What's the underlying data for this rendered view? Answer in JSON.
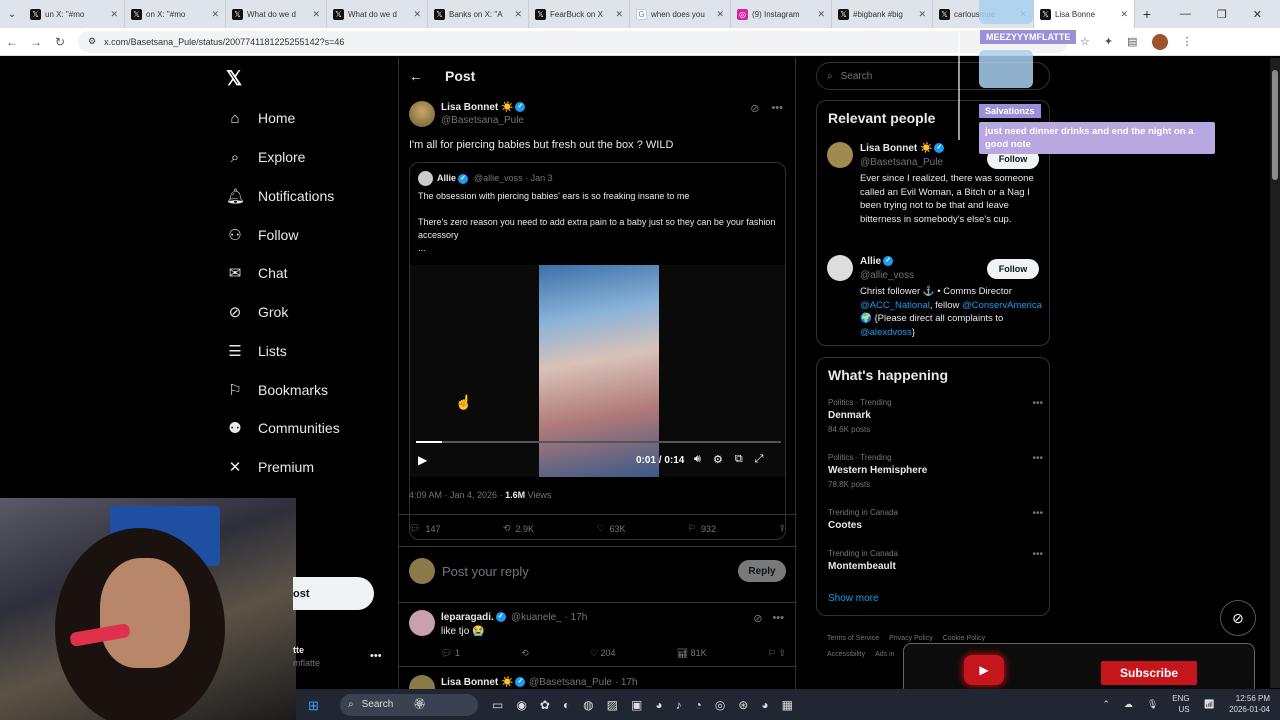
{
  "browser": {
    "tabs": [
      {
        "icon": "x-icon",
        "title": "un X: \"#mo",
        "active": false
      },
      {
        "icon": "x-icon",
        "title": "on X: \"#mo",
        "active": false
      },
      {
        "icon": "x-icon",
        "title": "What do we d",
        "active": false
      },
      {
        "icon": "x-icon",
        "title": "What do we d",
        "active": false
      },
      {
        "icon": "x-icon",
        "title": "Banks on X: \"A",
        "active": false
      },
      {
        "icon": "x-icon",
        "title": "FearBuck on X",
        "active": false
      },
      {
        "icon": "google-icon",
        "title": "when does you",
        "active": false
      },
      {
        "icon": "instagram-icon",
        "title": "(9) Instagram",
        "active": false
      },
      {
        "icon": "x-icon",
        "title": "#bigbank #big",
        "active": false
      },
      {
        "icon": "x-icon",
        "title": "carlousmae",
        "active": false
      },
      {
        "icon": "x-icon",
        "title": "Lisa Bonne",
        "active": true
      }
    ],
    "url": "x.com/Basetsana_Pule/status/2007741181225255142?s=46"
  },
  "nav": {
    "items": [
      {
        "icon": "home-icon",
        "glyph": "⌂",
        "label": "Home"
      },
      {
        "icon": "explore-icon",
        "glyph": "⌕",
        "label": "Explore"
      },
      {
        "icon": "bell-icon",
        "glyph": "🔔︎",
        "label": "Notifications"
      },
      {
        "icon": "follow-icon",
        "glyph": "⚇",
        "label": "Follow"
      },
      {
        "icon": "mail-icon",
        "glyph": "✉",
        "label": "Chat"
      },
      {
        "icon": "grok-icon",
        "glyph": "⊘",
        "label": "Grok"
      },
      {
        "icon": "lists-icon",
        "glyph": "☰",
        "label": "Lists"
      },
      {
        "icon": "bookmark-icon",
        "glyph": "⚐",
        "label": "Bookmarks"
      },
      {
        "icon": "communities-icon",
        "glyph": "⚉",
        "label": "Communities"
      },
      {
        "icon": "premium-icon",
        "glyph": "✕",
        "label": "Premium"
      }
    ],
    "post_label": "ost",
    "account_name": "tte",
    "account_user": "mflatte"
  },
  "post": {
    "header": "Post",
    "author_name": "Lisa Bonnet ☀️",
    "author_user": "@Basetsana_Pule",
    "text": "I'm all for piercing babies but fresh out the box ? WILD",
    "quote": {
      "name": "Allie",
      "user": "@allie_voss",
      "date": "· Jan 3",
      "line1": "The obsession with piercing babies' ears is so freaking insane to me",
      "line2": "There's zero reason you need to add extra pain to a baby just so they can be your fashion accessory",
      "line3": "...",
      "video_time": "0:01 / 0:14",
      "video_progress": 0.07
    },
    "timestamp": "4:09 AM · Jan 4, 2026 · ",
    "views": "1.6M",
    "views_label": " Views",
    "replies": "147",
    "reposts": "2.9K",
    "likes": "63K",
    "bookmarks": "932",
    "reply_placeholder": "Post your reply",
    "reply_button": "Reply"
  },
  "comments": [
    {
      "name": "leparagadi.",
      "user": "@kuanele_ · 17h",
      "text": "like tjo 😭",
      "replies": "1",
      "likes": "204",
      "views": "81K"
    },
    {
      "name": "Lisa Bonnet ☀️",
      "user": "@Basetsana_Pule · 17h"
    }
  ],
  "right": {
    "search_placeholder": "Search",
    "relevant_title": "Relevant people",
    "people": [
      {
        "name": "Lisa Bonnet ☀️",
        "user": "@Basetsana_Pule",
        "follow": "Follow",
        "bio": "Ever since I realized, there was someone called an Evil Woman, a Bitch or a Nag I been trying not to be that and leave bitterness in somebody's else's cup."
      },
      {
        "name": "Allie",
        "user": "@allie_voss",
        "follow": "Follow",
        "bio_a": "Christ follower ⚓ • Comms Director ",
        "bio_link1": "@ACC_National",
        "bio_b": ", fellow ",
        "bio_link2": "@ConservAmerica",
        "bio_c": " 🌍 {Please direct all complaints to ",
        "bio_link3": "@alexdvoss",
        "bio_d": "}"
      }
    ],
    "happening_title": "What's happening",
    "trends": [
      {
        "category": "Politics · Trending",
        "name": "Denmark",
        "count": "84.6K posts"
      },
      {
        "category": "Politics · Trending",
        "name": "Western Hemisphere",
        "count": "78.8K posts"
      },
      {
        "category": "Trending in Canada",
        "name": "Cootes",
        "count": ""
      },
      {
        "category": "Trending in Canada",
        "name": "Montembeault",
        "count": ""
      }
    ],
    "show_more": "Show more",
    "footer": [
      "Terms of Service",
      "Privacy Policy",
      "Cookie Policy",
      "Accessibility",
      "Ads in"
    ]
  },
  "overlay": {
    "name1": "MEEZYYYMFLATTE",
    "name1_color": "#9b8fd8",
    "name2": "Salvationzs",
    "name2_color": "#9b8fd8",
    "message": "just need dinner drinks and end the night on a good note",
    "subscribe": "Subscribe"
  },
  "taskbar": {
    "search": "Search",
    "lang": "ENG",
    "region": "US",
    "time": "12:56 PM",
    "date": "2026-01-04"
  }
}
